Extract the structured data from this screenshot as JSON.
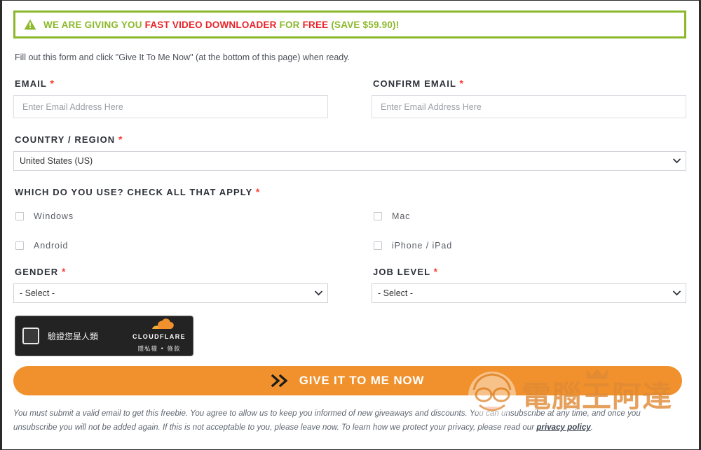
{
  "banner": {
    "icon": "warning-triangle-icon",
    "prefix": "WE ARE GIVING YOU ",
    "product": "FAST VIDEO DOWNLOADER",
    "middle": " FOR ",
    "free": "FREE",
    "suffix": " (SAVE $59.90)!",
    "border_color": "#8cb82b",
    "text_color": "#8cb82b",
    "highlight_color": "#e8242a"
  },
  "intro": {
    "text": "Fill out this form and click \"Give It To Me Now\" (at the bottom of this page) when ready."
  },
  "form": {
    "email": {
      "label": "EMAIL",
      "required_mark": "*",
      "placeholder": "Enter Email Address Here",
      "value": ""
    },
    "confirm_email": {
      "label": "CONFIRM EMAIL",
      "required_mark": "*",
      "placeholder": "Enter Email Address Here",
      "value": ""
    },
    "country": {
      "label": "COUNTRY / REGION",
      "required_mark": "*",
      "selected": "United States (US)"
    },
    "platforms": {
      "label": "WHICH DO YOU USE? CHECK ALL THAT APPLY",
      "required_mark": "*",
      "left": [
        {
          "label": "Windows",
          "checked": false
        },
        {
          "label": "Android",
          "checked": false
        }
      ],
      "right": [
        {
          "label": "Mac",
          "checked": false
        },
        {
          "label": "iPhone / iPad",
          "checked": false
        }
      ]
    },
    "gender": {
      "label": "GENDER",
      "required_mark": "*",
      "selected": "- Select -"
    },
    "job_level": {
      "label": "JOB LEVEL",
      "required_mark": "*",
      "selected": "- Select -"
    }
  },
  "turnstile": {
    "checkbox_name": "verify-human-checkbox",
    "verify_text": "驗證您是人類",
    "brand": "CLOUDFLARE",
    "links": "隱私權 • 條款",
    "background": "#232323"
  },
  "cta": {
    "label": "GIVE IT TO ME NOW",
    "icon": "double-chevron-right-icon",
    "color": "#f0912d"
  },
  "disclaimer": {
    "part1": "You must submit a valid email to get this freebie. You agree to allow us to keep you informed of new giveaways and discounts. You can unsubscribe at any time, and once you unsubscribe you will not be added again. If this is not acceptable to you, please leave now. To learn how we protect your privacy, please read our ",
    "link": "privacy policy",
    "part2": "."
  },
  "watermark": {
    "text": "電腦王阿達",
    "color": "#f0912d"
  }
}
